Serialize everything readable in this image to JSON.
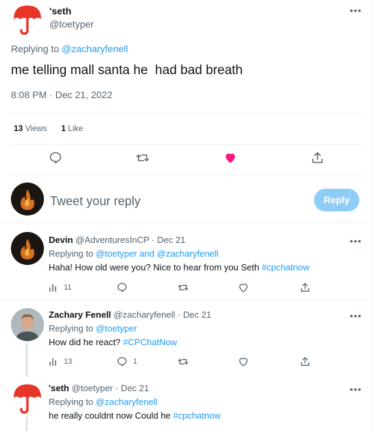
{
  "main_tweet": {
    "author_name": "'seth",
    "author_handle": "@toetyper",
    "replying_prefix": "Replying to",
    "replying_to": "@zacharyfenell",
    "text": "me telling mall santa he  had bad breath",
    "timestamp": "8:08 PM · Dec 21, 2022",
    "views_count": "13",
    "views_label": "Views",
    "likes_count": "1",
    "likes_label": "Like"
  },
  "compose": {
    "placeholder": "Tweet your reply",
    "button_label": "Reply"
  },
  "replies": [
    {
      "author_name": "Devin",
      "author_handle": "@AdventuresInCP",
      "date": "· Dec 21",
      "replying_prefix": "Replying to",
      "replying_to": "@toetyper and @zacharyfenell",
      "text": "Haha! How old were you? Nice to hear from you Seth",
      "hashtag": "#cpchatnow",
      "views": "11",
      "replies": "",
      "avatar": "fire-avatar"
    },
    {
      "author_name": "Zachary Fenell",
      "author_handle": "@zacharyfenell",
      "date": "· Dec 21",
      "replying_prefix": "Replying to",
      "replying_to": "@toetyper",
      "text": "How did he react?",
      "hashtag": "#CPChatNow",
      "views": "13",
      "replies": "1",
      "avatar": "person-avatar"
    },
    {
      "author_name": "'seth",
      "author_handle": "@toetyper",
      "date": "· Dec 21",
      "replying_prefix": "Replying to",
      "replying_to": "@zacharyfenell",
      "text": "he really couldnt now Could he",
      "hashtag": "#cpchatnow",
      "avatar": "umbrella-avatar"
    }
  ],
  "colors": {
    "accent": "#1d9bf0",
    "like_active": "#f91880",
    "umbrella": "#e8352a",
    "reply_button": "#8ecdf8",
    "secondary_text": "#536471"
  },
  "icons": [
    "umbrella-icon",
    "more-icon",
    "reply-icon",
    "retweet-icon",
    "heart-icon",
    "share-icon",
    "views-icon"
  ]
}
